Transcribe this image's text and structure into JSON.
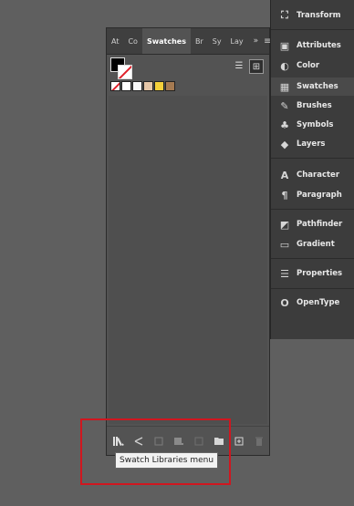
{
  "swatches_panel": {
    "tabs": [
      "At",
      "Co",
      "Swatches",
      "Br",
      "Sy",
      "Lay"
    ],
    "more_tabs": "»",
    "menu_glyph": "≡",
    "view_list_glyph": "☰",
    "view_grid_glyph": "⊞",
    "swatch_colors": [
      "#ffffff",
      "#f7f7f7",
      "#e5c6a8",
      "#f5d03a",
      "#a57a51"
    ]
  },
  "bottom_bar": {
    "icons": [
      "library-icon",
      "cut-icon",
      "swatch-options-icon",
      "show-kinds-icon",
      "new-color-group-icon",
      "folder-icon",
      "new-swatch-icon",
      "trash-icon"
    ]
  },
  "tooltip": {
    "text": "Swatch Libraries menu"
  },
  "dock": {
    "items": [
      {
        "label": "Transform",
        "icon": "⛶"
      },
      {
        "label": "Attributes",
        "icon": "▣"
      },
      {
        "label": "Color",
        "icon": "◐"
      },
      {
        "label": "Swatches",
        "icon": "▦"
      },
      {
        "label": "Brushes",
        "icon": "✎"
      },
      {
        "label": "Symbols",
        "icon": "♣"
      },
      {
        "label": "Layers",
        "icon": "◆"
      },
      {
        "label": "Character",
        "icon": "A"
      },
      {
        "label": "Paragraph",
        "icon": "¶"
      },
      {
        "label": "Pathfinder",
        "icon": "◩"
      },
      {
        "label": "Gradient",
        "icon": "▭"
      },
      {
        "label": "Properties",
        "icon": "☰"
      },
      {
        "label": "OpenType",
        "icon": "O"
      }
    ]
  },
  "colors": {
    "highlight": "#d0161f",
    "accent": "#e0202a"
  }
}
